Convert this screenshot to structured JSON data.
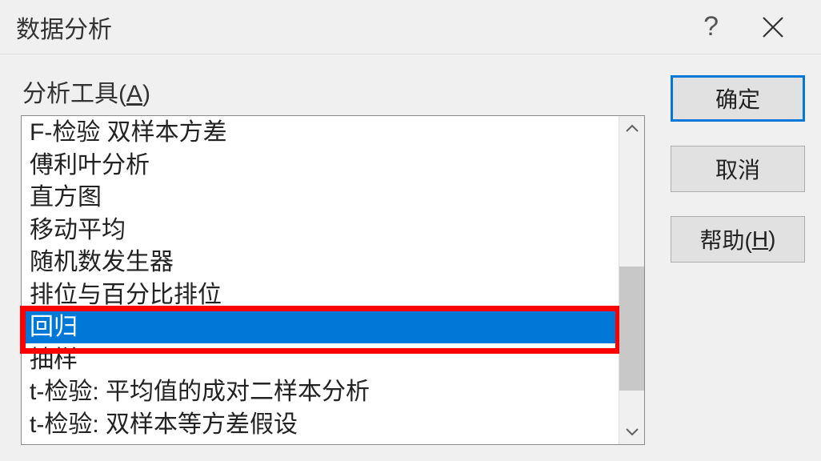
{
  "dialog": {
    "title": "数据分析",
    "label_prefix": "分析工具(",
    "label_key": "A",
    "label_suffix": ")"
  },
  "list": {
    "items": [
      "F-检验 双样本方差",
      "傅利叶分析",
      "直方图",
      "移动平均",
      "随机数发生器",
      "排位与百分比排位",
      "回归",
      "抽样",
      "t-检验: 平均值的成对二样本分析",
      "t-检验: 双样本等方差假设"
    ],
    "selected_index": 6
  },
  "buttons": {
    "ok": "确定",
    "cancel": "取消",
    "help_prefix": "帮助(",
    "help_key": "H",
    "help_suffix": ")"
  }
}
